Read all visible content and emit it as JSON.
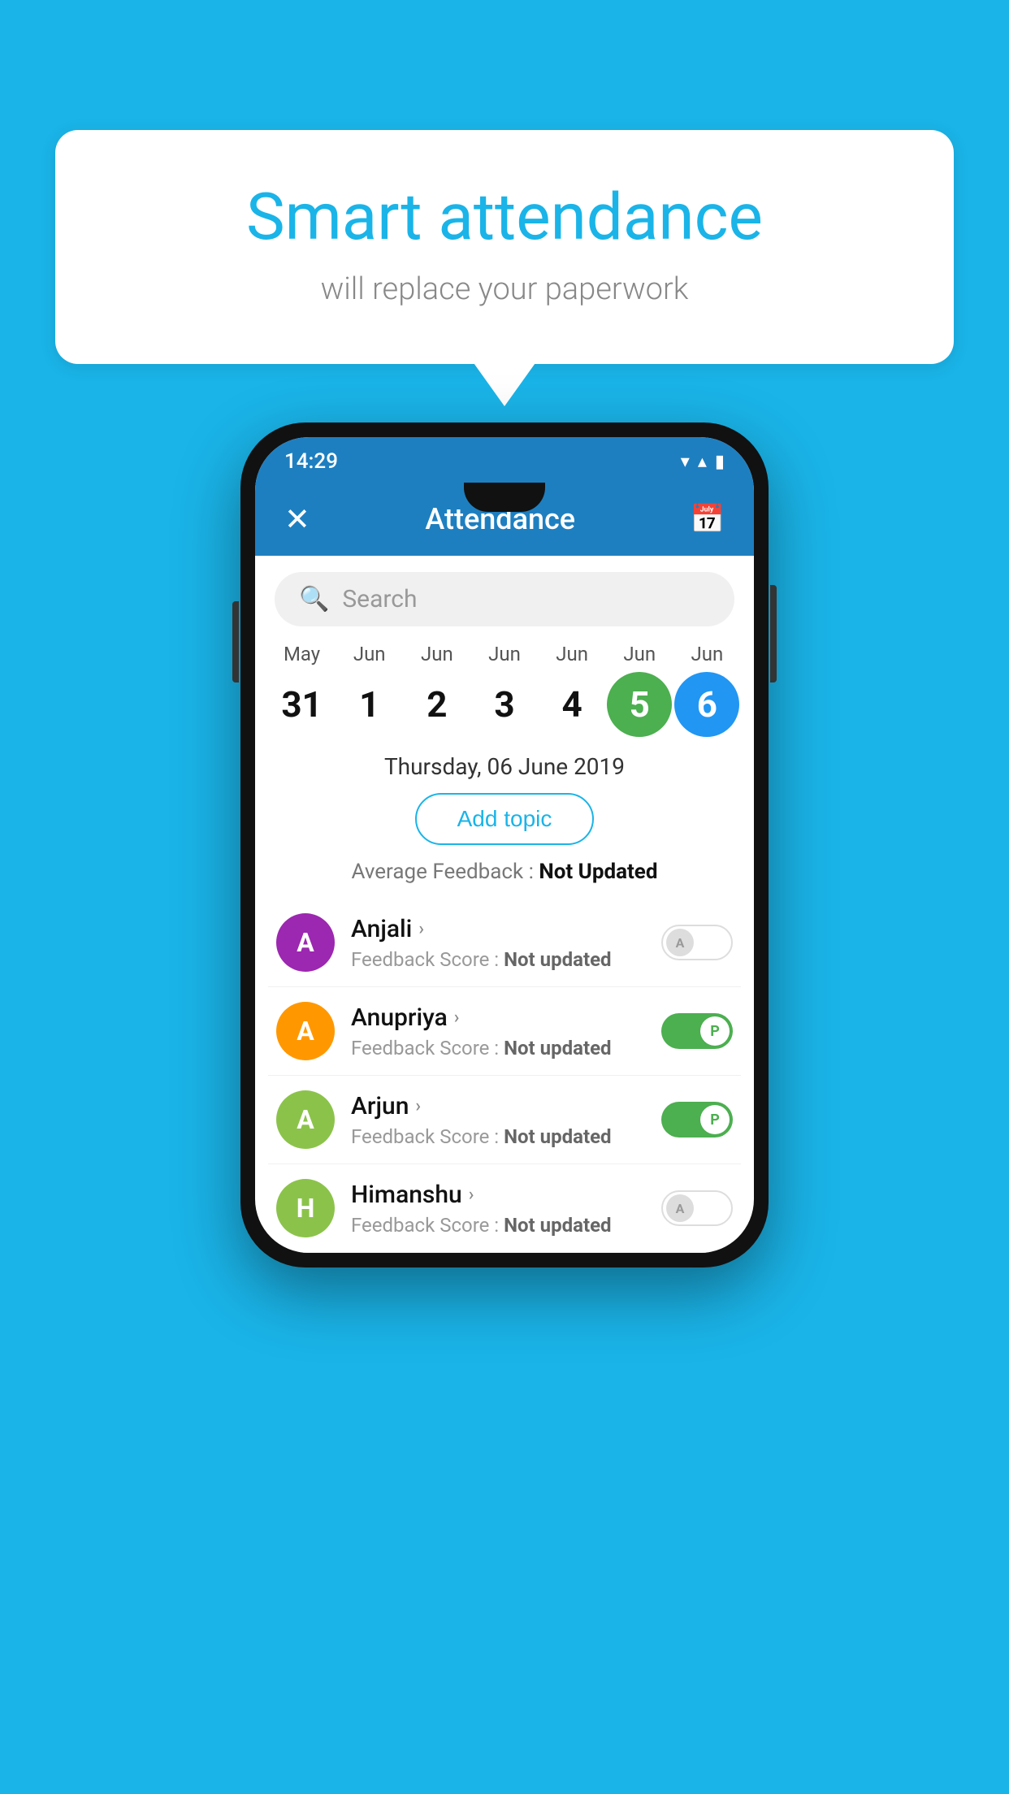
{
  "background_color": "#1ab4e8",
  "speech_bubble": {
    "title": "Smart attendance",
    "subtitle": "will replace your paperwork"
  },
  "status_bar": {
    "time": "14:29",
    "icons": "▾ ▴ 🔋"
  },
  "app_bar": {
    "close_label": "✕",
    "title": "Attendance",
    "calendar_icon": "📅"
  },
  "search": {
    "placeholder": "Search"
  },
  "calendar": {
    "days": [
      {
        "month": "May",
        "date": "31",
        "highlight": "none"
      },
      {
        "month": "Jun",
        "date": "1",
        "highlight": "none"
      },
      {
        "month": "Jun",
        "date": "2",
        "highlight": "none"
      },
      {
        "month": "Jun",
        "date": "3",
        "highlight": "none"
      },
      {
        "month": "Jun",
        "date": "4",
        "highlight": "none"
      },
      {
        "month": "Jun",
        "date": "5",
        "highlight": "green"
      },
      {
        "month": "Jun",
        "date": "6",
        "highlight": "blue"
      }
    ]
  },
  "selected_date": "Thursday, 06 June 2019",
  "add_topic_label": "Add topic",
  "average_feedback": {
    "label": "Average Feedback : ",
    "value": "Not Updated"
  },
  "students": [
    {
      "name": "Anjali",
      "avatar_letter": "A",
      "avatar_color": "purple",
      "feedback": "Not updated",
      "toggle_state": "off",
      "toggle_letter": "A"
    },
    {
      "name": "Anupriya",
      "avatar_letter": "A",
      "avatar_color": "orange",
      "feedback": "Not updated",
      "toggle_state": "on",
      "toggle_letter": "P"
    },
    {
      "name": "Arjun",
      "avatar_letter": "A",
      "avatar_color": "green",
      "feedback": "Not updated",
      "toggle_state": "on",
      "toggle_letter": "P"
    },
    {
      "name": "Himanshu",
      "avatar_letter": "H",
      "avatar_color": "lightgreen",
      "feedback": "Not updated",
      "toggle_state": "off",
      "toggle_letter": "A"
    }
  ],
  "feedback_label": "Feedback Score : "
}
